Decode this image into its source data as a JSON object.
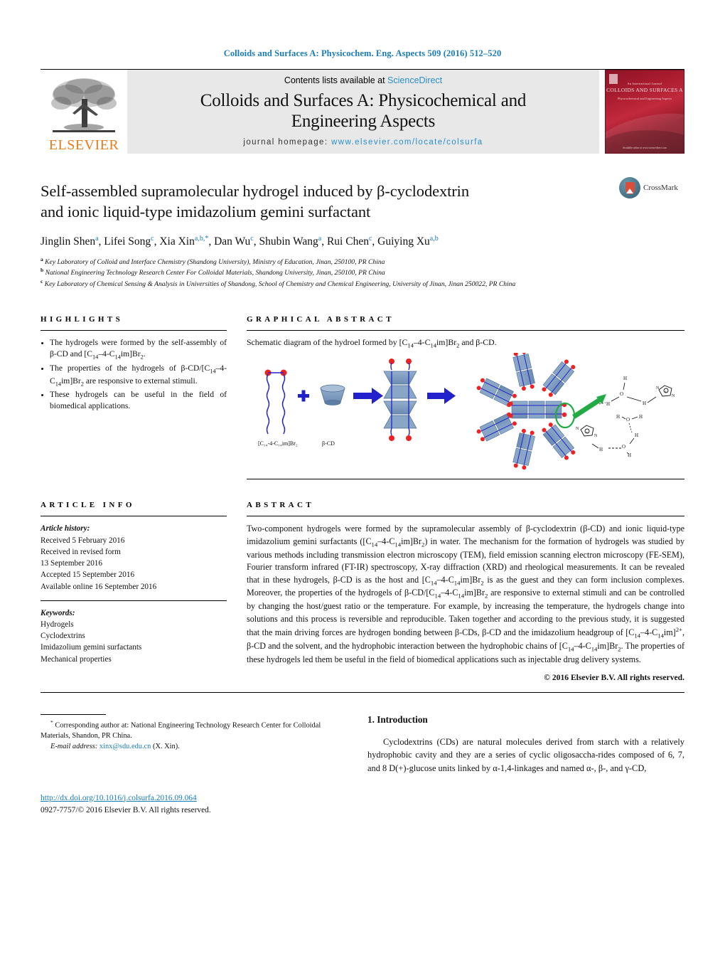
{
  "running_head": "Colloids and Surfaces A: Physicochem. Eng. Aspects 509 (2016) 512–520",
  "journal_header": {
    "contents_prefix": "Contents lists available at ",
    "sciencedirect": "ScienceDirect",
    "title_line1": "Colloids and Surfaces A: Physicochemical and",
    "title_line2": "Engineering Aspects",
    "homepage_label": "journal homepage:",
    "homepage_url": "www.elsevier.com/locate/colsurfa",
    "publisher": "ELSEVIER",
    "cover": {
      "line1": "An International Journal",
      "line2": "COLLOIDS AND SURFACES A",
      "line3": "Physicochemical and Engineering Aspects",
      "bottom": "Available online at www.sciencedirect.com"
    }
  },
  "article": {
    "title_line1": "Self-assembled supramolecular hydrogel induced by β-cyclodextrin",
    "title_line2": "and ionic liquid-type imidazolium gemini surfactant",
    "crossmark_label": "CrossMark",
    "authors": "Jinglin Shen a, Lifei Song c, Xia Xin a,b,*, Dan Wu c, Shubin Wang a, Rui Chen c, Guiying Xu a,b",
    "affiliations": [
      {
        "mark": "a",
        "text": "Key Laboratory of Colloid and Interface Chemistry (Shandong University), Ministry of Education, Jinan, 250100, PR China"
      },
      {
        "mark": "b",
        "text": "National Engineering Technology Research Center For Colloidal Materials, Shandong University, Jinan, 250100, PR China"
      },
      {
        "mark": "c",
        "text": "Key Laboratory of Chemical Sensing & Analysis in Universities of Shandong, School of Chemistry and Chemical Engineering, University of Jinan, Jinan 250022, PR China"
      }
    ]
  },
  "highlights": {
    "heading": "HIGHLIGHTS",
    "items": [
      "The hydrogels were formed by the self-assembly of β-CD and [C14–4-C14im]Br2.",
      "The properties of the hydrogels of β-CD/[C14–4-C14im]Br2 are responsive to external stimuli.",
      "These hydrogels can be useful in the field of biomedical applications."
    ]
  },
  "graphical_abstract": {
    "heading": "GRAPHICAL ABSTRACT",
    "caption": "Schematic diagram of the hydroel formed by [C14–4-C14im]Br2 and β-CD.",
    "labels": {
      "surfactant": "[C14-4-C14im]Br2",
      "cd": "β-CD"
    }
  },
  "article_info": {
    "heading": "ARTICLE INFO",
    "history_label": "Article history:",
    "history": [
      "Received 5 February 2016",
      "Received in revised form",
      "13 September 2016",
      "Accepted 15 September 2016",
      "Available online 16 September 2016"
    ],
    "keywords_label": "Keywords:",
    "keywords": [
      "Hydrogels",
      "Cyclodextrins",
      "Imidazolium gemini surfactants",
      "Mechanical properties"
    ]
  },
  "abstract": {
    "heading": "ABSTRACT",
    "text": "Two-component hydrogels were formed by the supramolecular assembly of β-cyclodextrin (β-CD) and ionic liquid-type imidazolium gemini surfactants ([C14–4-C14im]Br2) in water. The mechanism for the formation of hydrogels was studied by various methods including transmission electron microscopy (TEM), field emission scanning electron microscopy (FE-SEM), Fourier transform infrared (FT-IR) spectroscopy, X-ray diffraction (XRD) and rheological measurements. It can be revealed that in these hydrogels, β-CD is as the host and [C14–4-C14im]Br2 is as the guest and they can form inclusion complexes. Moreover, the properties of the hydrogels of β-CD/[C14–4-C14im]Br2 are responsive to external stimuli and can be controlled by changing the host/guest ratio or the temperature. For example, by increasing the temperature, the hydrogels change into solutions and this process is reversible and reproducible. Taken together and according to the previous study, it is suggested that the main driving forces are hydrogen bonding between β-CDs, β-CD and the imidazolium headgroup of [C14–4-C14im]2+, β-CD and the solvent, and the hydrophobic interaction between the hydrophobic chains of [C14–4-C14im]Br2. The properties of these hydrogels led them be useful in the field of biomedical applications such as injectable drug delivery systems.",
    "copyright": "© 2016 Elsevier B.V. All rights reserved."
  },
  "introduction": {
    "heading": "1. Introduction",
    "text": "Cyclodextrins (CDs) are natural molecules derived from starch with a relatively hydrophobic cavity and they are a series of cyclic oligosaccha-rides composed of 6, 7, and 8 D(+)-glucose units linked by α-1,4-linkages and named α-, β-, and γ-CD,"
  },
  "footer": {
    "corresponding_marker": "*",
    "corresponding_text": "Corresponding author at: National Engineering Technology Research Center for Colloidal Materials, Shandon, PR China.",
    "email_label": "E-mail address:",
    "email": "xinx@sdu.edu.cn",
    "email_owner": "(X. Xin).",
    "doi": "http://dx.doi.org/10.1016/j.colsurfa.2016.09.064",
    "issn": "0927-7757/© 2016 Elsevier B.V. All rights reserved."
  },
  "colors": {
    "link_blue": "#1a7bb9",
    "elsevier_orange": "#e87d1e",
    "band_gray": "#e8e8e8",
    "diagram_blue": "#2222cc",
    "diagram_red": "#ee2222",
    "diagram_green": "#22aa44",
    "cd_fill": "#7e9cc0"
  }
}
